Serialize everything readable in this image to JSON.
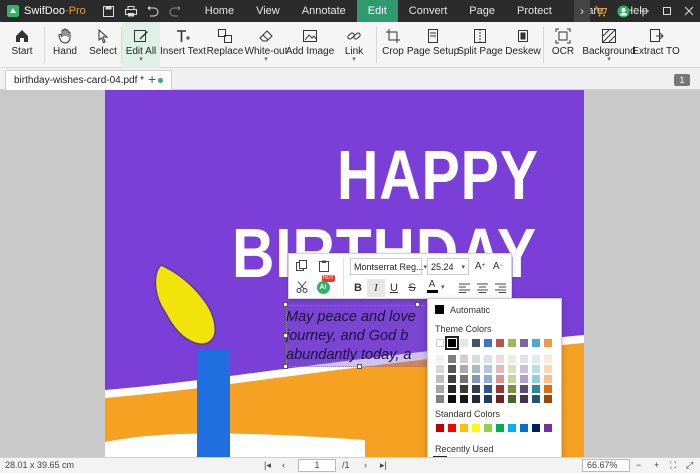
{
  "app": {
    "name": "SwifDoo",
    "edition": "·Pro"
  },
  "menu": [
    "Home",
    "View",
    "Annotate",
    "Edit",
    "Convert",
    "Page",
    "Protect",
    "Share",
    "Help"
  ],
  "menu_active": "Edit",
  "ribbon": [
    {
      "label": "Start",
      "icon": "home-icon"
    },
    {
      "label": "Hand",
      "icon": "hand-icon"
    },
    {
      "label": "Select",
      "icon": "cursor-icon"
    },
    {
      "label": "Edit All",
      "icon": "edit-icon",
      "active": true
    },
    {
      "label": "Insert Text",
      "icon": "text-insert-icon"
    },
    {
      "label": "Replace",
      "icon": "replace-icon"
    },
    {
      "label": "White-out",
      "icon": "eraser-icon"
    },
    {
      "label": "Add Image",
      "icon": "image-icon"
    },
    {
      "label": "Link",
      "icon": "link-icon"
    },
    {
      "label": "Crop",
      "icon": "crop-icon"
    },
    {
      "label": "Page Setup",
      "icon": "page-setup-icon"
    },
    {
      "label": "Split Page",
      "icon": "split-icon"
    },
    {
      "label": "Deskew",
      "icon": "deskew-icon"
    },
    {
      "label": "OCR",
      "icon": "ocr-icon"
    },
    {
      "label": "Background",
      "icon": "background-icon"
    },
    {
      "label": "Extract TO",
      "icon": "extract-icon"
    }
  ],
  "tab": {
    "filename": "birthday-wishes-card-04.pdf *",
    "count": "1"
  },
  "card": {
    "line1": "HAPPY",
    "line2": "BIRTHDAY",
    "message": [
      "May peace and love",
      "journey, and God b",
      "abundantly today, a"
    ]
  },
  "format": {
    "font": "Montserrat Reg...",
    "size": "25.24",
    "ai_badge": "AI",
    "hot_badge": "HOT"
  },
  "color_popup": {
    "automatic": "Automatic",
    "theme_label": "Theme Colors",
    "standard_label": "Standard Colors",
    "recent_label": "Recently Used",
    "theme_top": [
      "#ffffff",
      "#000000",
      "#e7e6e6",
      "#44546a",
      "#4472c4",
      "#c0504d",
      "#9bbb59",
      "#8064a2",
      "#4bacc6",
      "#f79646"
    ],
    "theme_shades": [
      [
        "#f2f2f2",
        "#7f7f7f",
        "#d0cece",
        "#d6dce5",
        "#d9e1f2",
        "#f2dcdb",
        "#ebf1de",
        "#e4dfec",
        "#dbeef4",
        "#fde9d9"
      ],
      [
        "#d9d9d9",
        "#595959",
        "#aeaaaa",
        "#adb9ca",
        "#b4c6e7",
        "#e6b8b7",
        "#d8e4bc",
        "#ccc0da",
        "#b7dee8",
        "#fcd5b4"
      ],
      [
        "#bfbfbf",
        "#404040",
        "#757171",
        "#8497b0",
        "#8ea9db",
        "#da9694",
        "#c4d79b",
        "#b1a0c7",
        "#92cddc",
        "#fabf8f"
      ],
      [
        "#a6a6a6",
        "#262626",
        "#3a3838",
        "#333f4f",
        "#2f5496",
        "#963634",
        "#76933c",
        "#60497a",
        "#31869b",
        "#e26b0a"
      ],
      [
        "#808080",
        "#0d0d0d",
        "#171616",
        "#222a35",
        "#1f3864",
        "#632523",
        "#4f6228",
        "#403151",
        "#215967",
        "#974706"
      ]
    ],
    "standard": [
      "#c00000",
      "#ff0000",
      "#ffc000",
      "#ffff00",
      "#92d050",
      "#00b050",
      "#00b0f0",
      "#0070c0",
      "#002060",
      "#7030a0"
    ],
    "recent": [
      "#000000",
      "#e0303a",
      "#ffd400",
      "#ff0000",
      "#ffffff",
      "#0a6fd0",
      "#f3c8f0",
      "#e8c8f8",
      "#3aa0d0",
      "#2fa14a"
    ]
  },
  "status": {
    "dimensions": "28.01 x 39.65 cm",
    "page": "1",
    "total": "/1",
    "zoom": "66.67%"
  }
}
